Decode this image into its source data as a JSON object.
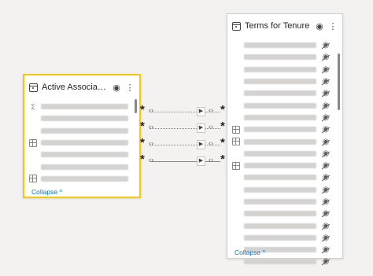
{
  "left_table": {
    "title": "Active Associates for ...",
    "collapse_label": "Collapse ^",
    "fields": [
      {
        "icon": "sigma-icon"
      },
      {
        "icon": "none"
      },
      {
        "icon": "none"
      },
      {
        "icon": "table-icon"
      },
      {
        "icon": "none"
      },
      {
        "icon": "none"
      },
      {
        "icon": "table-icon"
      }
    ]
  },
  "right_table": {
    "title": "Terms for Tenure",
    "collapse_label": "Collapse ^",
    "fields": [
      {
        "icon": "none"
      },
      {
        "icon": "none"
      },
      {
        "icon": "none"
      },
      {
        "icon": "none"
      },
      {
        "icon": "none"
      },
      {
        "icon": "none"
      },
      {
        "icon": "none"
      },
      {
        "icon": "table-icon"
      },
      {
        "icon": "table-icon"
      },
      {
        "icon": "none"
      },
      {
        "icon": "table-icon"
      },
      {
        "icon": "none"
      },
      {
        "icon": "none"
      },
      {
        "icon": "none"
      },
      {
        "icon": "none"
      },
      {
        "icon": "none"
      },
      {
        "icon": "none"
      },
      {
        "icon": "none"
      },
      {
        "icon": "none"
      }
    ]
  },
  "relationships": [
    {
      "from_cardinality": "*",
      "to_cardinality": "*",
      "style": "dotted"
    },
    {
      "from_cardinality": "*",
      "to_cardinality": "*",
      "style": "dotted"
    },
    {
      "from_cardinality": "*",
      "to_cardinality": "*",
      "style": "dotted"
    },
    {
      "from_cardinality": "*",
      "to_cardinality": "*",
      "style": "solid"
    }
  ],
  "colors": {
    "selected_border": "#f2c811",
    "link": "#0078d4"
  }
}
